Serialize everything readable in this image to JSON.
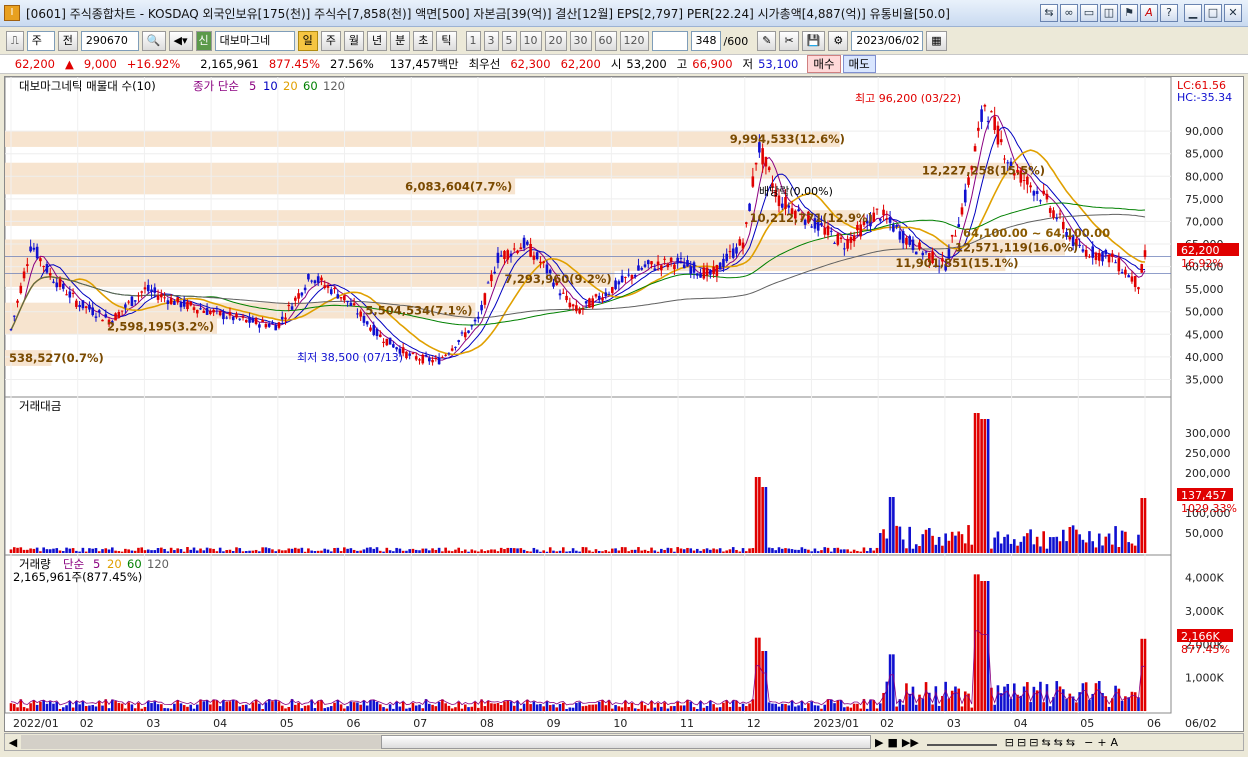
{
  "window": {
    "title": "[0601] 주식종합차트 - KOSDAQ 외국인보유[175(천)] 주식수[7,858(천)] 액면[500] 자본금[39(억)] 결산[12월] EPS[2,797] PER[22.24] 시가총액[4,887(억)] 유통비율[50.0]",
    "icon": "I"
  },
  "toolbar": {
    "market": "주",
    "prev_label": "전",
    "code": "290670",
    "stock_name": "대보마그네",
    "periods": [
      "일",
      "주",
      "월",
      "년",
      "분",
      "초",
      "틱"
    ],
    "selected_period": "일",
    "intervals": [
      "1",
      "3",
      "5",
      "10",
      "20",
      "30",
      "60",
      "120"
    ],
    "count": "348",
    "count_max": "/600",
    "date": "2023/06/02"
  },
  "quote": {
    "price": "62,200",
    "change": "9,000",
    "change_pct": "+16.92%",
    "volume": "2,165,961",
    "vol_ratio": "877.45%",
    "turnover": "27.56%",
    "amount": "137,457백만",
    "best_label": "최우선",
    "ask": "62,300",
    "bid": "62,200",
    "open_label": "시",
    "open": "53,200",
    "high_label": "고",
    "high": "66,900",
    "low_label": "저",
    "low": "53,100",
    "buy_label": "매수",
    "sell_label": "매도"
  },
  "colors": {
    "up": "#e00000",
    "down": "#1010d0",
    "ma5": "#8b0080",
    "ma10": "#0000c0",
    "ma20": "#e0a000",
    "ma60": "#008000",
    "ma120": "#606060",
    "profile": "#f7e4cf"
  },
  "panels": {
    "price": {
      "title": "대보마그네틱 매물대 수(10)",
      "ma_label": "종가 단순",
      "ma": [
        "5",
        "10",
        "20",
        "60",
        "120"
      ],
      "lc": "LC:61.56",
      "hc": "HC:-35.34",
      "price_tag": "62,200",
      "pct_tag": "16.92%",
      "high_note": "최고 96,200 (03/22)",
      "low_note": "최저 38,500 (07/13)",
      "div_note": "배당락(0.00%)",
      "range_note": "64,100.00 ~ 64,100.00",
      "profile": [
        "538,527(0.7%)",
        "2,598,195(3.2%)",
        "5,504,534(7.1%)",
        "7,293,960(9.2%)",
        "10,212,771(12.9%)",
        "12,571,119(16.0%)",
        "11,901,851(15.1%)",
        "6,083,604(7.7%)",
        "9,994,533(12.6%)",
        "12,227,258(15.5%)"
      ]
    },
    "amount": {
      "title": "거래대금",
      "tag": "137,457",
      "pct": "1029.33%"
    },
    "volume": {
      "title": "거래량",
      "ma_label": "단순",
      "ma": [
        "5",
        "20",
        "60",
        "120"
      ],
      "sub": "2,165,961주(877.45%)",
      "tag": "2,166K",
      "pct": "877.45%"
    }
  },
  "chart_data": [
    {
      "type": "candlestick",
      "title": "대보마그네틱",
      "x": [
        "2022/01",
        "02",
        "03",
        "04",
        "05",
        "06",
        "07",
        "08",
        "09",
        "10",
        "11",
        "12",
        "2023/01",
        "02",
        "03",
        "04",
        "05",
        "06"
      ],
      "y_ticks": [
        35000,
        40000,
        45000,
        50000,
        55000,
        60000,
        65000,
        70000,
        75000,
        80000,
        85000,
        90000
      ],
      "ylim": [
        32000,
        98000
      ],
      "close_path": [
        [
          0,
          46000
        ],
        [
          0.3,
          65000
        ],
        [
          0.6,
          58000
        ],
        [
          1,
          52000
        ],
        [
          1.5,
          48000
        ],
        [
          2,
          55000
        ],
        [
          2.5,
          52000
        ],
        [
          3,
          50000
        ],
        [
          3.5,
          48000
        ],
        [
          4,
          47000
        ],
        [
          4.5,
          58000
        ],
        [
          5,
          53000
        ],
        [
          5.5,
          45000
        ],
        [
          6,
          40000
        ],
        [
          6.4,
          39000
        ],
        [
          7,
          48000
        ],
        [
          7.3,
          62000
        ],
        [
          7.7,
          65000
        ],
        [
          8,
          60000
        ],
        [
          8.3,
          53000
        ],
        [
          8.5,
          50000
        ],
        [
          9,
          55000
        ],
        [
          9.5,
          60000
        ],
        [
          10,
          61000
        ],
        [
          10.5,
          58000
        ],
        [
          11,
          66000
        ],
        [
          11.2,
          87000
        ],
        [
          11.5,
          75000
        ],
        [
          12,
          70000
        ],
        [
          12.5,
          65000
        ],
        [
          13,
          72000
        ],
        [
          13.5,
          65000
        ],
        [
          14,
          60000
        ],
        [
          14.3,
          75000
        ],
        [
          14.6,
          96200
        ],
        [
          15,
          82000
        ],
        [
          15.5,
          75000
        ],
        [
          16,
          64000
        ],
        [
          16.5,
          62000
        ],
        [
          16.9,
          56000
        ],
        [
          17,
          62200
        ]
      ],
      "profile": [
        {
          "price_low": 38000,
          "price_high": 41500,
          "volume": 538527,
          "pct": 0.7
        },
        {
          "price_low": 45000,
          "price_high": 48500,
          "volume": 2598195,
          "pct": 3.2
        },
        {
          "price_low": 48500,
          "price_high": 52000,
          "volume": 5504534,
          "pct": 7.1
        },
        {
          "price_low": 55500,
          "price_high": 59000,
          "volume": 7293960,
          "pct": 9.2
        },
        {
          "price_low": 69000,
          "price_high": 72500,
          "volume": 10212771,
          "pct": 12.9
        },
        {
          "price_low": 62500,
          "price_high": 66000,
          "volume": 12571119,
          "pct": 16.0
        },
        {
          "price_low": 59000,
          "price_high": 62500,
          "volume": 11901851,
          "pct": 15.1
        },
        {
          "price_low": 76000,
          "price_high": 79500,
          "volume": 6083604,
          "pct": 7.7
        },
        {
          "price_low": 86500,
          "price_high": 90000,
          "volume": 9994533,
          "pct": 12.6
        },
        {
          "price_low": 79500,
          "price_high": 83000,
          "volume": 12227258,
          "pct": 15.5
        }
      ]
    },
    {
      "type": "bar",
      "title": "거래대금",
      "y_ticks": [
        50000,
        100000,
        150000,
        200000,
        250000,
        300000
      ],
      "ylim": [
        0,
        350000
      ],
      "spikes": [
        [
          11.2,
          190000
        ],
        [
          11.3,
          165000
        ],
        [
          13.2,
          140000
        ],
        [
          14.5,
          350000
        ],
        [
          14.6,
          335000
        ],
        [
          17,
          137457
        ]
      ]
    },
    {
      "type": "bar",
      "title": "거래량",
      "y_ticks": [
        1000,
        2000,
        3000,
        4000
      ],
      "ylim": [
        0,
        4200
      ],
      "spikes": [
        [
          11.2,
          2200
        ],
        [
          11.3,
          1800
        ],
        [
          13.2,
          1700
        ],
        [
          14.5,
          4100
        ],
        [
          14.6,
          3900
        ],
        [
          17,
          2166
        ]
      ]
    }
  ]
}
